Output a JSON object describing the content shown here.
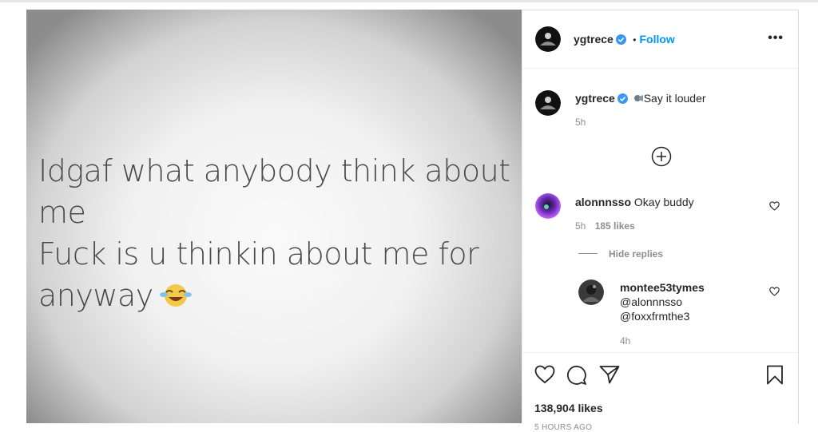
{
  "post": {
    "text_lines": [
      "Idgaf what anybody think about",
      "me",
      "Fuck is u thinkin about me for",
      "anyway"
    ],
    "emoji": "laughing-crying-emoji"
  },
  "header": {
    "username": "ygtrece",
    "separator": "•",
    "follow_label": "Follow",
    "more_label": "•••"
  },
  "caption": {
    "username": "ygtrece",
    "text": "Say it louder",
    "time": "5h"
  },
  "load_more_label": "+",
  "comments": [
    {
      "username": "alonnnsso",
      "text": "Okay buddy",
      "time": "5h",
      "likes": "185 likes"
    }
  ],
  "hide_replies_label": "Hide replies",
  "replies": [
    {
      "username": "montee53tymes",
      "mention1": "@alonnnsso",
      "mention2": "@foxxfrmthe3",
      "time": "4h"
    }
  ],
  "footer": {
    "likes": "138,904 likes",
    "time_ago": "5 HOURS AGO"
  },
  "colors": {
    "accent": "#0095f6",
    "text": "#262626",
    "muted": "#8e8e8e"
  }
}
